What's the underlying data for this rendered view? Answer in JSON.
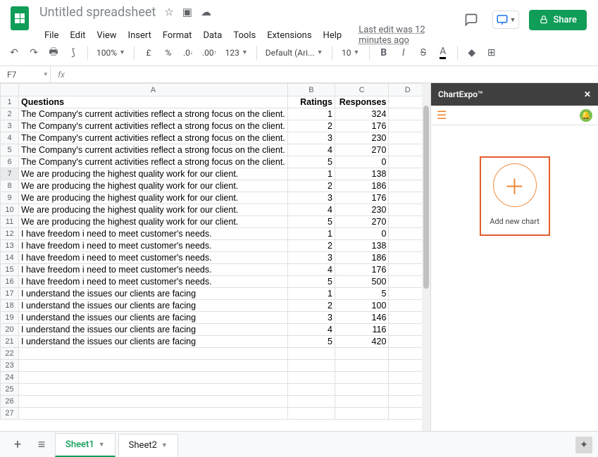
{
  "doc": {
    "title": "Untitled spreadsheet",
    "last_edit": "Last edit was 12 minutes ago"
  },
  "menus": {
    "file": "File",
    "edit": "Edit",
    "view": "View",
    "insert": "Insert",
    "format": "Format",
    "data": "Data",
    "tools": "Tools",
    "extensions": "Extensions",
    "help": "Help"
  },
  "share": {
    "label": "Share"
  },
  "toolbar": {
    "zoom": "100%",
    "currency": "£",
    "percent": "%",
    "dec_dec": ".0",
    "dec_inc": ".00",
    "more_fmt": "123",
    "font": "Default (Ari...",
    "fontsize": "10",
    "bold": "B",
    "italic": "I",
    "strike": "S",
    "textcolor": "A"
  },
  "formula": {
    "cellref": "F7",
    "fx": "fx",
    "value": ""
  },
  "columns": {
    "A": "A",
    "B": "B",
    "C": "C",
    "D": "D"
  },
  "rows_labels": [
    "1",
    "2",
    "3",
    "4",
    "5",
    "6",
    "7",
    "8",
    "9",
    "10",
    "11",
    "12",
    "13",
    "14",
    "15",
    "16",
    "17",
    "18",
    "19",
    "20",
    "21",
    "22",
    "23",
    "24",
    "25",
    "26",
    "27"
  ],
  "header_row": {
    "A": "Questions",
    "B": "Ratings",
    "C": "Responses"
  },
  "data_rows": [
    {
      "q": "The Company's current activities reflect a strong focus on the client.",
      "r": "1",
      "c": "324"
    },
    {
      "q": "The Company's current activities reflect a strong focus on the client.",
      "r": "2",
      "c": "176"
    },
    {
      "q": "The Company's current activities reflect a strong focus on the client.",
      "r": "3",
      "c": "230"
    },
    {
      "q": "The Company's current activities reflect a strong focus on the client.",
      "r": "4",
      "c": "270"
    },
    {
      "q": "The Company's current activities reflect a strong focus on the client.",
      "r": "5",
      "c": "0"
    },
    {
      "q": "We are producing the highest quality work for our client.",
      "r": "1",
      "c": "138"
    },
    {
      "q": "We are producing the highest quality work for our client.",
      "r": "2",
      "c": "186"
    },
    {
      "q": "We are producing the highest quality work for our client.",
      "r": "3",
      "c": "176"
    },
    {
      "q": "We are producing the highest quality work for our client.",
      "r": "4",
      "c": "230"
    },
    {
      "q": "We are producing the highest quality work for our client.",
      "r": "5",
      "c": "270"
    },
    {
      "q": "I have freedom i need to meet customer's needs.",
      "r": "1",
      "c": "0"
    },
    {
      "q": "I have freedom i need to meet customer's needs.",
      "r": "2",
      "c": "138"
    },
    {
      "q": "I have freedom i need to meet customer's needs.",
      "r": "3",
      "c": "186"
    },
    {
      "q": "I have freedom i need to meet customer's needs.",
      "r": "4",
      "c": "176"
    },
    {
      "q": "I have freedom i need to meet customer's needs.",
      "r": "5",
      "c": "500"
    },
    {
      "q": "I understand the issues our clients are facing",
      "r": "1",
      "c": "5"
    },
    {
      "q": "I understand the issues our clients are facing",
      "r": "2",
      "c": "100"
    },
    {
      "q": "I understand the issues our clients are facing",
      "r": "3",
      "c": "146"
    },
    {
      "q": "I understand the issues our clients are facing",
      "r": "4",
      "c": "116"
    },
    {
      "q": "I understand the issues our clients are facing",
      "r": "5",
      "c": "420"
    }
  ],
  "panel": {
    "title": "ChartExpo™",
    "add_label": "Add new chart"
  },
  "sheets": {
    "sheet1": "Sheet1",
    "sheet2": "Sheet2"
  }
}
